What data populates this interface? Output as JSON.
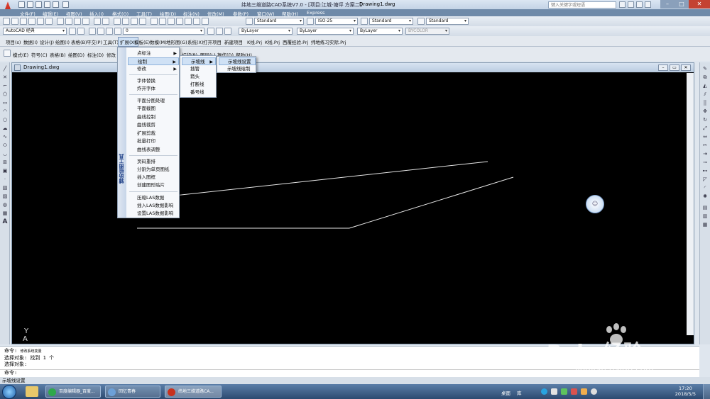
{
  "window": {
    "title": "纬地三维道路CAD系统V7.0 - [项目:江城-塘坪 方案二]",
    "drawing_name": "Drawing1.dwg",
    "help_search_placeholder": "键入关键字或短语"
  },
  "menubar": [
    "文件(F)",
    "编辑(E)",
    "视图(V)",
    "插入(I)",
    "格式(O)",
    "工具(T)",
    "绘图(D)",
    "标注(N)",
    "修改(M)",
    "参数(P)",
    "窗口(W)",
    "帮助(H)",
    "Express"
  ],
  "toolbar": {
    "text_style": "Standard",
    "dim_style": "ISO-25",
    "table_style": "Standard",
    "mleader_style": "Standard",
    "workspace": "AutoCAD 经典",
    "layer": "0",
    "color": "ByLayer",
    "linetype": "ByLayer",
    "lineweight": "ByLayer",
    "plotstyle": "BYCOLOR"
  },
  "project_tabs": [
    "项目(s)",
    "数据(I)",
    "设计(J)",
    "绘图(I)",
    "表格(B)",
    "平交(P)",
    "工具(T)",
    "扩展(X)",
    "模板(E)",
    "数模(M)",
    "地形图(G)",
    "系统(X)",
    "打开项目",
    "新建项目",
    "K线.Prj",
    "K线.Prj",
    "西覆经验.Prj",
    "纬地练习实际.Prj"
  ],
  "extra_toolbar": [
    "模式(E)",
    "符号(C)",
    "表格(B)",
    "绘图(D)",
    "标注(D)",
    "修改",
    "打印(P)",
    "图层(L)",
    "操作(D)",
    "帮助(H)"
  ],
  "menu_main": {
    "side_label": "辅助绘图工具",
    "items": [
      {
        "label": "点标注",
        "submenu": true
      },
      {
        "label": "绘制",
        "submenu": true,
        "highlight": true
      },
      {
        "label": "修改",
        "submenu": true
      },
      {
        "label": "字体替换"
      },
      {
        "label": "炸开字体"
      },
      {
        "label": "平面分图处理"
      },
      {
        "label": "平面截图"
      },
      {
        "label": "曲线控制"
      },
      {
        "label": "曲线裁剪"
      },
      {
        "label": "扩展剪裁"
      },
      {
        "label": "批量打印"
      },
      {
        "label": "曲线表调整"
      },
      {
        "label": "页码重排"
      },
      {
        "label": "分割为单页图纸"
      },
      {
        "label": "插入图框"
      },
      {
        "label": "创建图形贴片"
      },
      {
        "label": "压缩LAS数据"
      },
      {
        "label": "插入LAS数据影响"
      },
      {
        "label": "设置LAS数据影响"
      }
    ]
  },
  "menu_sub1": [
    {
      "label": "示坡线",
      "highlight": true
    },
    {
      "label": "插管"
    },
    {
      "label": "箭头"
    },
    {
      "label": "打断线"
    },
    {
      "label": "番号线"
    }
  ],
  "menu_sub2": [
    {
      "label": "示坡线设置",
      "highlight": true
    },
    {
      "label": "示坡线绘制"
    }
  ],
  "command": {
    "line1_prompt": "命令:",
    "line1_value": "修改系统变量",
    "line2": "选择对象: 找到 1 个",
    "line3": "选择对象:",
    "input_prompt": "命令:"
  },
  "statusbar": {
    "text": "示坡线设置"
  },
  "taskbar": {
    "apps": [
      {
        "label": "百度编辑器_百度...",
        "color": "#2ea84a"
      },
      {
        "label": "回忆青春",
        "color": "#6da0d8"
      },
      {
        "label": "纬地三维道路CA...",
        "color": "#c8321e"
      }
    ],
    "tray_text": "桌面",
    "tray_lib": "库",
    "time": "17:20",
    "date": "2018/5/5"
  },
  "ucs": {
    "y": "Y",
    "a": "A"
  },
  "watermark": {
    "brand": "Bai",
    "brand2": "经验",
    "url": "jingyan.baidu.com"
  },
  "colors": {
    "canvas": "#000000",
    "lines": "#e6e6e6",
    "menubar": "#6f8aa9",
    "highlight": "#cfe1f5"
  }
}
